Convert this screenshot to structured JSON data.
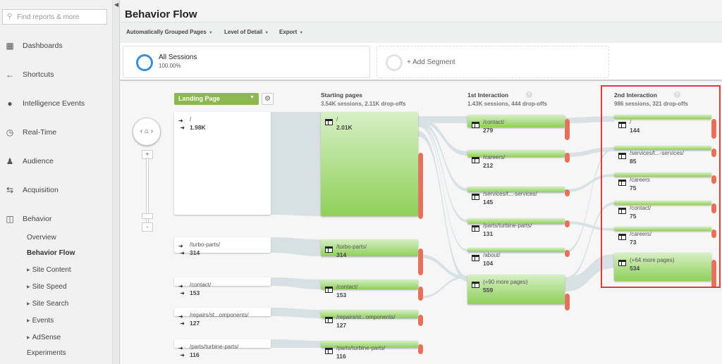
{
  "sidebar": {
    "search_placeholder": "Find reports & more",
    "items": [
      {
        "label": "Dashboards",
        "icon": "grid-icon"
      },
      {
        "label": "Shortcuts",
        "icon": "shortcut-arrow-icon"
      },
      {
        "label": "Intelligence Events",
        "icon": "lightbulb-icon"
      },
      {
        "label": "Real-Time",
        "icon": "clock-icon"
      },
      {
        "label": "Audience",
        "icon": "people-icon"
      },
      {
        "label": "Acquisition",
        "icon": "acquisition-arrows-icon"
      },
      {
        "label": "Behavior",
        "icon": "layout-icon"
      }
    ],
    "behavior_sub": [
      {
        "label": "Overview",
        "expandable": false,
        "active": false
      },
      {
        "label": "Behavior Flow",
        "expandable": false,
        "active": true
      },
      {
        "label": "Site Content",
        "expandable": true,
        "active": false
      },
      {
        "label": "Site Speed",
        "expandable": true,
        "active": false
      },
      {
        "label": "Site Search",
        "expandable": true,
        "active": false
      },
      {
        "label": "Events",
        "expandable": true,
        "active": false
      },
      {
        "label": "AdSense",
        "expandable": true,
        "active": false
      },
      {
        "label": "Experiments",
        "expandable": false,
        "active": false
      }
    ]
  },
  "header": {
    "title": "Behavior Flow"
  },
  "toolbar": {
    "grouping": "Automatically Grouped Pages",
    "detail": "Level of Detail",
    "export": "Export"
  },
  "segments": {
    "active_name": "All Sessions",
    "active_pct": "100.00%",
    "add_label": "+ Add Segment",
    "accent": "#3a8fd6"
  },
  "flow": {
    "dimension": "Landing Page",
    "colors": {
      "node": "#8fd05a",
      "dropoff": "#e8705a",
      "link": "#d7e0e2",
      "highlight": "#e53935"
    },
    "columns": [
      {
        "title": "Starting pages",
        "stats": "3.54K sessions, 2.11K drop-offs"
      },
      {
        "title": "1st Interaction",
        "stats": "1.43K sessions, 444 drop-offs"
      },
      {
        "title": "2nd Interaction",
        "stats": "986 sessions, 321 drop-offs"
      }
    ],
    "landing": [
      {
        "page": "/",
        "count": "1.98K"
      },
      {
        "page": "/turbo-parts/",
        "count": "314"
      },
      {
        "page": "/contact/",
        "count": "153"
      },
      {
        "page": "/repairs/st...omponents/",
        "count": "127"
      },
      {
        "page": "/parts/turbine-parts/",
        "count": "116"
      }
    ],
    "starting": [
      {
        "page": "/",
        "count": "2.01K"
      },
      {
        "page": "/turbo-parts/",
        "count": "314"
      },
      {
        "page": "/contact/",
        "count": "153"
      },
      {
        "page": "/repairs/st...omponents/",
        "count": "127"
      },
      {
        "page": "/parts/turbine-parts/",
        "count": "116"
      }
    ],
    "first": [
      {
        "page": "/contact/",
        "count": "279"
      },
      {
        "page": "/careers/",
        "count": "212"
      },
      {
        "page": "/services/t...-services/",
        "count": "145"
      },
      {
        "page": "/parts/turbine-parts/",
        "count": "131"
      },
      {
        "page": "/about/",
        "count": "104"
      },
      {
        "page": "(+90 more pages)",
        "count": "559"
      }
    ],
    "second": [
      {
        "page": "/",
        "count": "144"
      },
      {
        "page": "/services/t...-services/",
        "count": "85"
      },
      {
        "page": "/careers",
        "count": "75"
      },
      {
        "page": "/contact/",
        "count": "75"
      },
      {
        "page": "/careers/",
        "count": "73"
      },
      {
        "page": "(+64 more pages)",
        "count": "534"
      }
    ]
  }
}
